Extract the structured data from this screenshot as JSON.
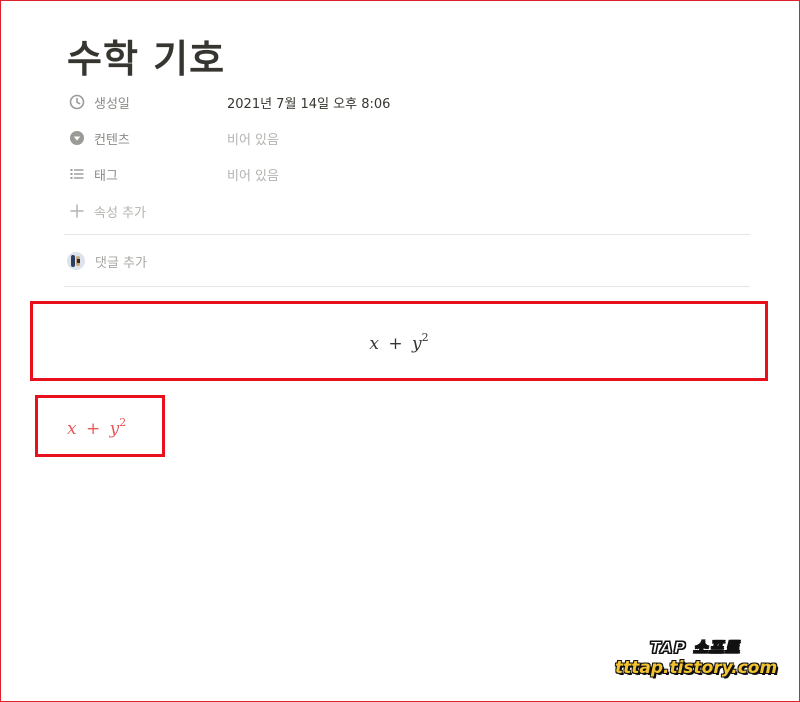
{
  "page": {
    "title": "수학 기호"
  },
  "properties": [
    {
      "icon": "clock-icon",
      "label": "생성일",
      "value": "2021년 7월 14일 오후 8:06"
    },
    {
      "icon": "dropdown-circle-icon",
      "label": "컨텐츠",
      "value": "비어 있음"
    },
    {
      "icon": "list-icon",
      "label": "태그",
      "value": "비어 있음"
    }
  ],
  "add_property": {
    "icon": "plus-icon",
    "label": "속성 추가"
  },
  "comment": {
    "label": "댓글 추가"
  },
  "equations": {
    "block": {
      "base_a": "x",
      "op": "+",
      "base_b": "y",
      "exp": "2"
    },
    "inline": {
      "base_a": "x",
      "op": "+",
      "base_b": "y",
      "exp": "2"
    }
  },
  "watermark": {
    "line1": "TAP 소프트",
    "line2": "tttap.tistory.com"
  },
  "colors": {
    "highlight_border": "#e8101c",
    "inline_equation": "#eb5757",
    "text_primary": "#37352f",
    "text_muted": "#8c8b87",
    "text_placeholder": "#b4b3b0"
  }
}
